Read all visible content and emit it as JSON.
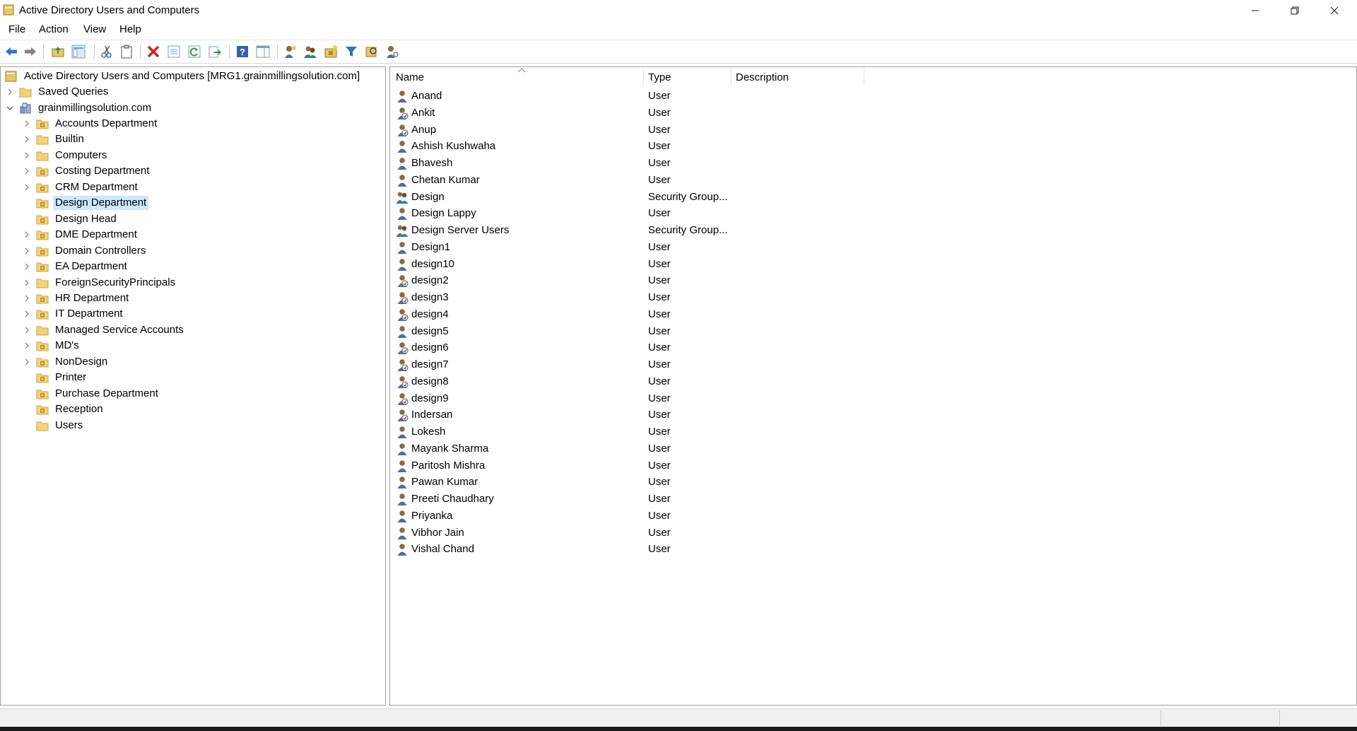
{
  "window": {
    "title": "Active Directory Users and Computers"
  },
  "menu": [
    "File",
    "Action",
    "View",
    "Help"
  ],
  "toolbar": {
    "icons": [
      "back-icon",
      "forward-icon",
      "up-folder-icon",
      "show-console-tree-icon",
      "cut-icon",
      "paste-icon",
      "delete-icon",
      "properties-icon",
      "refresh-icon",
      "export-list-icon",
      "help-icon",
      "show-action-pane-icon",
      "new-user-icon",
      "new-group-icon",
      "new-ou-icon",
      "filter-icon",
      "find-icon",
      "delegate-control-icon"
    ]
  },
  "tree": {
    "root": "Active Directory Users and Computers [MRG1.grainmillingsolution.com]",
    "saved_queries": "Saved Queries",
    "domain": "grainmillingsolution.com",
    "children": [
      {
        "label": "Accounts Department",
        "expandable": true,
        "ou": true
      },
      {
        "label": "Builtin",
        "expandable": true,
        "ou": false
      },
      {
        "label": "Computers",
        "expandable": true,
        "ou": false
      },
      {
        "label": "Costing Department",
        "expandable": true,
        "ou": true
      },
      {
        "label": "CRM Department",
        "expandable": true,
        "ou": true
      },
      {
        "label": "Design Department",
        "expandable": false,
        "ou": true,
        "selected": true
      },
      {
        "label": "Design Head",
        "expandable": false,
        "ou": true
      },
      {
        "label": "DME Department",
        "expandable": true,
        "ou": true
      },
      {
        "label": "Domain Controllers",
        "expandable": true,
        "ou": true
      },
      {
        "label": "EA Department",
        "expandable": true,
        "ou": true
      },
      {
        "label": "ForeignSecurityPrincipals",
        "expandable": true,
        "ou": false
      },
      {
        "label": "HR Department",
        "expandable": true,
        "ou": true
      },
      {
        "label": "IT Department",
        "expandable": true,
        "ou": true
      },
      {
        "label": "Managed Service Accounts",
        "expandable": true,
        "ou": false
      },
      {
        "label": "MD's",
        "expandable": true,
        "ou": true
      },
      {
        "label": "NonDesign",
        "expandable": true,
        "ou": true
      },
      {
        "label": "Printer",
        "expandable": false,
        "ou": true
      },
      {
        "label": "Purchase Department",
        "expandable": false,
        "ou": true
      },
      {
        "label": "Reception",
        "expandable": false,
        "ou": true
      },
      {
        "label": "Users",
        "expandable": false,
        "ou": false
      }
    ]
  },
  "list": {
    "columns": {
      "name": "Name",
      "type": "Type",
      "description": "Description"
    },
    "rows": [
      {
        "name": "Anand",
        "type": "User",
        "icon": "user-icon"
      },
      {
        "name": "Ankit",
        "type": "User",
        "icon": "disabled-user-icon"
      },
      {
        "name": "Anup",
        "type": "User",
        "icon": "disabled-user-icon"
      },
      {
        "name": "Ashish Kushwaha",
        "type": "User",
        "icon": "user-icon"
      },
      {
        "name": "Bhavesh",
        "type": "User",
        "icon": "user-icon"
      },
      {
        "name": "Chetan Kumar",
        "type": "User",
        "icon": "user-icon"
      },
      {
        "name": "Design",
        "type": "Security Group...",
        "icon": "group-icon"
      },
      {
        "name": "Design Lappy",
        "type": "User",
        "icon": "user-icon"
      },
      {
        "name": "Design Server Users",
        "type": "Security Group...",
        "icon": "group-icon"
      },
      {
        "name": "Design1",
        "type": "User",
        "icon": "user-icon"
      },
      {
        "name": "design10",
        "type": "User",
        "icon": "user-icon"
      },
      {
        "name": "design2",
        "type": "User",
        "icon": "disabled-user-icon"
      },
      {
        "name": "design3",
        "type": "User",
        "icon": "disabled-user-icon"
      },
      {
        "name": "design4",
        "type": "User",
        "icon": "disabled-user-icon"
      },
      {
        "name": "design5",
        "type": "User",
        "icon": "user-icon"
      },
      {
        "name": "design6",
        "type": "User",
        "icon": "disabled-user-icon"
      },
      {
        "name": "design7",
        "type": "User",
        "icon": "disabled-user-icon"
      },
      {
        "name": "design8",
        "type": "User",
        "icon": "disabled-user-icon"
      },
      {
        "name": "design9",
        "type": "User",
        "icon": "disabled-user-icon"
      },
      {
        "name": "Indersan",
        "type": "User",
        "icon": "disabled-user-icon"
      },
      {
        "name": "Lokesh",
        "type": "User",
        "icon": "user-icon"
      },
      {
        "name": "Mayank Sharma",
        "type": "User",
        "icon": "user-icon"
      },
      {
        "name": "Paritosh Mishra",
        "type": "User",
        "icon": "user-icon"
      },
      {
        "name": "Pawan Kumar",
        "type": "User",
        "icon": "user-icon"
      },
      {
        "name": "Preeti Chaudhary",
        "type": "User",
        "icon": "user-icon"
      },
      {
        "name": "Priyanka",
        "type": "User",
        "icon": "user-icon"
      },
      {
        "name": "Vibhor Jain",
        "type": "User",
        "icon": "user-icon"
      },
      {
        "name": "Vishal Chand",
        "type": "User",
        "icon": "user-icon"
      }
    ]
  },
  "colors": {
    "selection": "#cce8ff",
    "folder": "#e8c66a",
    "ou_mark": "#b58b2a"
  }
}
